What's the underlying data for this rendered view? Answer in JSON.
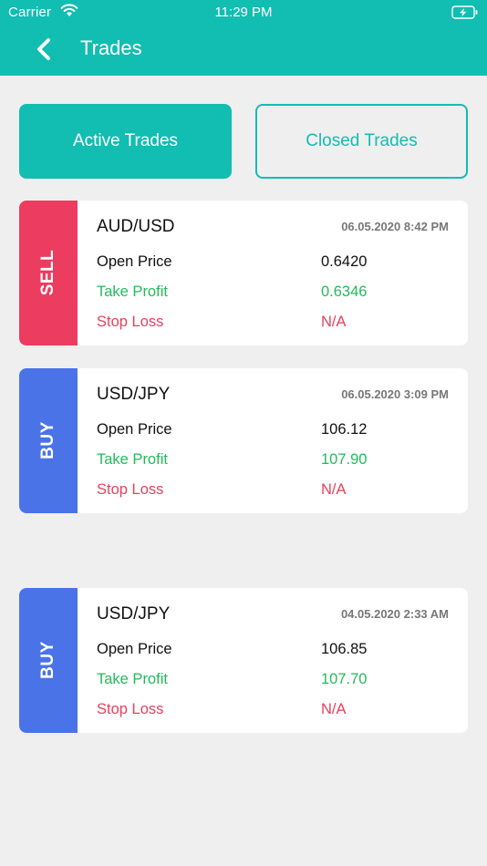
{
  "status_bar": {
    "carrier": "Carrier",
    "time": "11:29 PM"
  },
  "header": {
    "title": "Trades"
  },
  "tabs": [
    {
      "label": "Active Trades",
      "active": true
    },
    {
      "label": "Closed Trades",
      "active": false
    }
  ],
  "colors": {
    "accent": "#12bdb1",
    "sell": "#ec3c5f",
    "buy": "#4a73e8",
    "profit": "#22bb5a",
    "loss": "#e8405c"
  },
  "trades": [
    {
      "side": "SELL",
      "pair": "AUD/USD",
      "date": "06.05.2020 8:42 PM",
      "open_price_label": "Open Price",
      "open_price": "0.6420",
      "take_profit_label": "Take Profit",
      "take_profit": "0.6346",
      "stop_loss_label": "Stop Loss",
      "stop_loss": "N/A"
    },
    {
      "side": "BUY",
      "pair": "USD/JPY",
      "date": "06.05.2020 3:09 PM",
      "open_price_label": "Open Price",
      "open_price": "106.12",
      "take_profit_label": "Take Profit",
      "take_profit": "107.90",
      "stop_loss_label": "Stop Loss",
      "stop_loss": "N/A"
    },
    {
      "side": "BUY",
      "pair": "USD/JPY",
      "date": "04.05.2020 2:33 AM",
      "open_price_label": "Open Price",
      "open_price": "106.85",
      "take_profit_label": "Take Profit",
      "take_profit": "107.70",
      "stop_loss_label": "Stop Loss",
      "stop_loss": "N/A"
    }
  ]
}
